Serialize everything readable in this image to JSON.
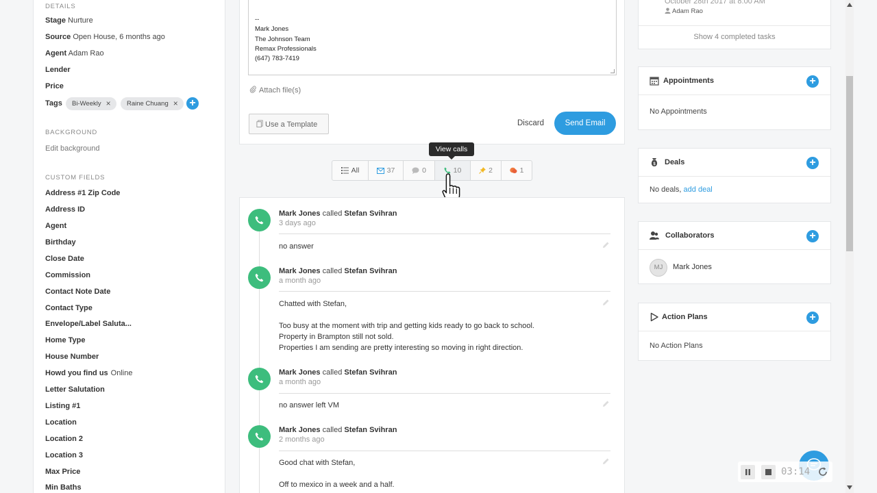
{
  "details": {
    "section_title": "DETAILS",
    "rows": [
      {
        "label": "Stage",
        "value": "Nurture"
      },
      {
        "label": "Source",
        "value": "Open House, 6 months ago"
      },
      {
        "label": "Agent",
        "value": "Adam Rao"
      },
      {
        "label": "Lender",
        "value": ""
      },
      {
        "label": "Price",
        "value": ""
      }
    ],
    "tags_label": "Tags",
    "tags": [
      "Bi-Weekly",
      "Raine Chuang"
    ]
  },
  "background": {
    "section_title": "BACKGROUND",
    "edit_link": "Edit background"
  },
  "custom_fields": {
    "section_title": "CUSTOM FIELDS",
    "rows": [
      {
        "label": "Address #1 Zip Code",
        "value": ""
      },
      {
        "label": "Address ID",
        "value": ""
      },
      {
        "label": "Agent",
        "value": ""
      },
      {
        "label": "Birthday",
        "value": ""
      },
      {
        "label": "Close Date",
        "value": ""
      },
      {
        "label": "Commission",
        "value": ""
      },
      {
        "label": "Contact Note Date",
        "value": ""
      },
      {
        "label": "Contact Type",
        "value": ""
      },
      {
        "label": "Envelope/Label Saluta...",
        "value": ""
      },
      {
        "label": "Home Type",
        "value": ""
      },
      {
        "label": "House Number",
        "value": ""
      },
      {
        "label": "Howd you find us",
        "value": "Online"
      },
      {
        "label": "Letter Salutation",
        "value": ""
      },
      {
        "label": "Listing #1",
        "value": ""
      },
      {
        "label": "Location",
        "value": ""
      },
      {
        "label": "Location 2",
        "value": ""
      },
      {
        "label": "Location 3",
        "value": ""
      },
      {
        "label": "Max Price",
        "value": ""
      },
      {
        "label": "Min Baths",
        "value": ""
      }
    ]
  },
  "email": {
    "signature_lines": [
      "--",
      "Mark Jones",
      "The Johnson Team",
      "Remax Professionals",
      "(647) 783-7419"
    ],
    "attach_label": "Attach file(s)",
    "template_button": "Use a Template",
    "discard_button": "Discard",
    "send_button": "Send Email"
  },
  "tooltip": "View calls",
  "filters": {
    "all": "All",
    "emails": "37",
    "texts": "0",
    "calls": "10",
    "notes": "2",
    "events": "1"
  },
  "calls": [
    {
      "caller": "Mark Jones",
      "verb": "called",
      "callee": "Stefan Svihran",
      "time": "3 days ago",
      "note_lines": [
        "no answer"
      ]
    },
    {
      "caller": "Mark Jones",
      "verb": "called",
      "callee": "Stefan Svihran",
      "time": "a month ago",
      "note_lines": [
        "Chatted with Stefan,",
        "",
        "Too busy at the moment with trip and getting kids ready to go back to school.",
        "Property in Brampton still not sold.",
        "Properties I am sending are pretty interesting so moving in right direction."
      ]
    },
    {
      "caller": "Mark Jones",
      "verb": "called",
      "callee": "Stefan Svihran",
      "time": "a month ago",
      "note_lines": [
        "no answer left VM"
      ]
    },
    {
      "caller": "Mark Jones",
      "verb": "called",
      "callee": "Stefan Svihran",
      "time": "2 months ago",
      "note_lines": [
        "Good chat with Stefan,",
        "",
        "Off to mexico in a week and a half."
      ]
    }
  ],
  "task": {
    "date": "October 28th 2017 at 8:00 AM",
    "assignee": "Adam Rao",
    "show_completed": "Show 4 completed tasks"
  },
  "appointments": {
    "title": "Appointments",
    "empty": "No Appointments"
  },
  "deals": {
    "title": "Deals",
    "empty": "No deals,",
    "add_link": "add deal"
  },
  "collaborators": {
    "title": "Collaborators",
    "initials": "MJ",
    "name": "Mark Jones"
  },
  "action_plans": {
    "title": "Action Plans",
    "empty": "No Action Plans"
  },
  "recorder": {
    "timer": "03:14"
  },
  "colors": {
    "accent": "#2e9ce0",
    "call_green": "#3dbd7d"
  }
}
